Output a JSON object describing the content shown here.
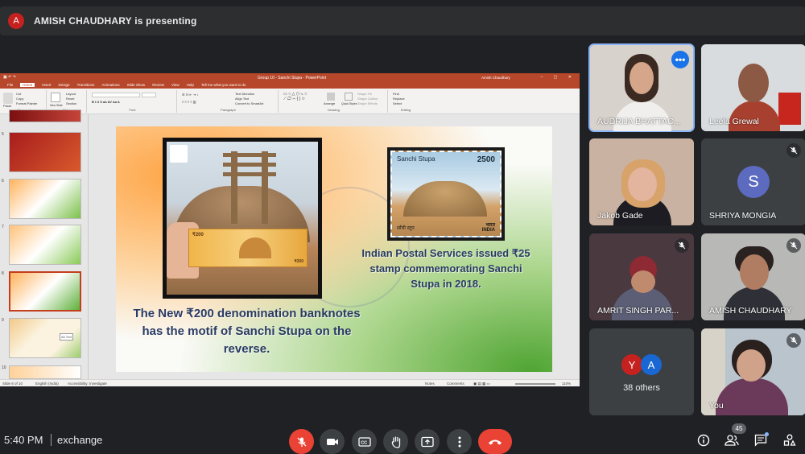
{
  "presenter_bar": {
    "avatar_letter": "A",
    "text": "AMISH CHAUDHARY is presenting"
  },
  "ppt": {
    "window_title": "Group 10 - Sanchi Stupa  -  PowerPoint",
    "user": "Amish Chaudhary",
    "menu": [
      "File",
      "Home",
      "Insert",
      "Design",
      "Transitions",
      "Animations",
      "Slide Show",
      "Review",
      "View",
      "Help",
      "Tell me what you want to do"
    ],
    "ribbon_groups": [
      "Clipboard",
      "Slides",
      "Font",
      "Paragraph",
      "Drawing",
      "Editing"
    ],
    "ribbon_items": {
      "paste": "Paste",
      "cut": "Cut",
      "copy": "Copy",
      "format_painter": "Format Painter",
      "new_slide": "New Slide",
      "layout": "Layout",
      "reset": "Reset",
      "section": "Section",
      "text_direction": "Text Direction",
      "align_text": "Align Text",
      "smartart": "Convert to SmartArt",
      "arrange": "Arrange",
      "quick_styles": "Quick Styles",
      "shape_fill": "Shape Fill",
      "shape_outline": "Shape Outline",
      "shape_effects": "Shape Effects",
      "find": "Find",
      "replace": "Replace",
      "select": "Select"
    },
    "thumb_numbers": [
      "5",
      "6",
      "7",
      "8",
      "9",
      "10"
    ],
    "status": {
      "slide": "Slide 8 of 10",
      "language": "English (India)",
      "accessibility": "Accessibility: Investigate",
      "notes": "Notes",
      "comments": "Comments",
      "zoom": "110%"
    },
    "slide": {
      "banknote_caption": "The New ₹200 denomination banknotes has the motif of Sanchi Stupa on the reverse.",
      "stamp_caption": "Indian Postal Services issued ₹25 stamp commemorating Sanchi Stupa in 2018.",
      "stamp_title": "Sanchi Stupa",
      "stamp_value": "2500",
      "stamp_hindi": "साँची स्तूप",
      "stamp_country_hindi": "भारत",
      "stamp_country": "INDIA",
      "note_value": "₹200",
      "thumb_callout": "Alt Text"
    }
  },
  "participants": [
    {
      "name": "AUDRIJA BHATTAC...",
      "speaking": true,
      "muted": false
    },
    {
      "name": "Leela Grewal",
      "speaking": false,
      "muted": false
    },
    {
      "name": "Jakob Gade",
      "speaking": false,
      "muted": false
    },
    {
      "name": "SHRIYA MONGIA",
      "avatar_letter": "S",
      "muted": true
    },
    {
      "name": "AMRIT SINGH PAR...",
      "muted": true
    },
    {
      "name": "AMISH CHAUDHARY",
      "muted": true
    },
    {
      "others_label": "38 others",
      "avatar_letters": [
        "Y",
        "A"
      ],
      "avatar_colors": [
        "#c5221f",
        "#1967d2"
      ]
    },
    {
      "name": "You",
      "muted": true
    }
  ],
  "bottom": {
    "time": "5:40 PM",
    "meeting": "exchange",
    "people_count": "45"
  },
  "colors": {
    "end_call": "#ea4335",
    "accent": "#8ab4f8",
    "ppt_brand": "#b7472a"
  }
}
